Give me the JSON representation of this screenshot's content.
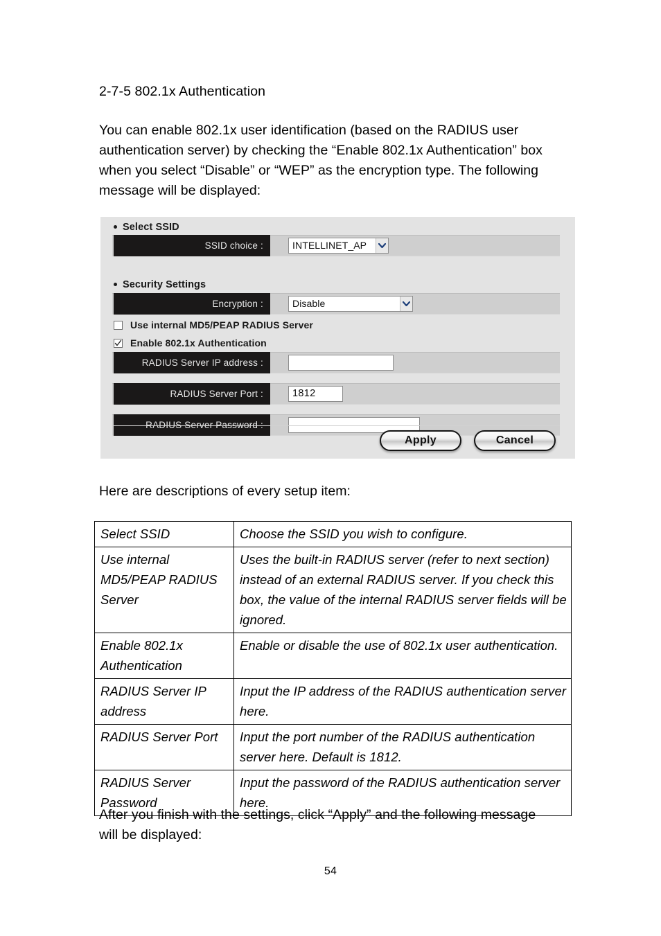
{
  "document": {
    "heading": "2-7-5 802.1x Authentication",
    "intro_paragraph": "You can enable 802.1x user identification (based on the RADIUS user authentication server) by checking the “Enable 802.1x Authentication” box when you select “Disable” or “WEP” as the encryption type. The following message will be displayed:",
    "descriptions_lead": "Here are descriptions of every setup item:",
    "closing_paragraph": "After you finish with the settings, click “Apply” and the following message will be displayed:",
    "page_number": "54"
  },
  "screenshot": {
    "sections": {
      "select_ssid": "Select SSID",
      "security_settings": "Security Settings"
    },
    "fields": {
      "ssid_choice": {
        "label": "SSID choice :",
        "value": "INTELLINET_AP"
      },
      "encryption": {
        "label": "Encryption :",
        "value": "Disable"
      },
      "radius_ip": {
        "label": "RADIUS Server IP address :",
        "value": ""
      },
      "radius_port": {
        "label": "RADIUS Server Port :",
        "value": "1812"
      },
      "radius_password": {
        "label": "RADIUS Server Password :",
        "value": ""
      }
    },
    "checkboxes": {
      "use_internal_radius": {
        "label": "Use internal MD5/PEAP RADIUS Server",
        "checked": false
      },
      "enable_8021x": {
        "label": "Enable 802.1x Authentication",
        "checked": true
      }
    },
    "buttons": {
      "apply": "Apply",
      "cancel": "Cancel"
    },
    "colors": {
      "panel_background": "#e3e3e3",
      "row_background": "#cfcfcf",
      "label_background": "#1a1818",
      "label_text": "#e8e8e8"
    }
  },
  "table": {
    "rows": [
      {
        "term": "Select SSID",
        "definition": "Choose the SSID you wish to configure."
      },
      {
        "term": "Use internal MD5/PEAP RADIUS Server",
        "definition": "Uses the built-in RADIUS server (refer to next section) instead of an external RADIUS server. If you check this box, the value of the internal RADIUS server fields will be ignored."
      },
      {
        "term": "Enable 802.1x Authentication",
        "definition": "Enable or disable the use of 802.1x user authentication."
      },
      {
        "term": "RADIUS Server IP address",
        "definition": "Input the IP address of the RADIUS authentication server here."
      },
      {
        "term": "RADIUS Server Port",
        "definition": "Input the port number of the RADIUS authentication server here. Default is 1812."
      },
      {
        "term": "RADIUS Server Password",
        "definition": "Input the password of the RADIUS authentication server here."
      }
    ]
  }
}
